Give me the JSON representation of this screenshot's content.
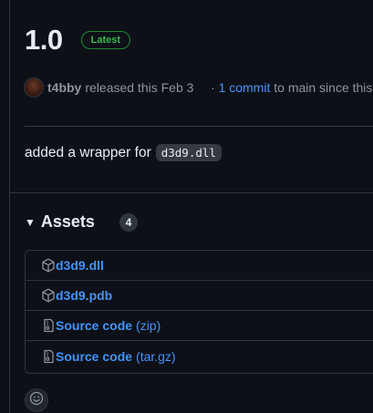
{
  "release": {
    "title": "1.0",
    "badge": "Latest",
    "author": "t4bby",
    "released_text": "released this Feb 3",
    "commits_prefix": "· ",
    "commits_link": "1 commit",
    "commits_suffix": " to main since this"
  },
  "body": {
    "text": "added a wrapper for",
    "code": "d3d9.dll"
  },
  "assets": {
    "label": "Assets",
    "count": "4",
    "items": [
      {
        "name": "d3d9.dll",
        "sub": "",
        "icon": "package-icon"
      },
      {
        "name": "d3d9.pdb",
        "sub": "",
        "icon": "package-icon"
      },
      {
        "name": "Source code",
        "sub": "(zip)",
        "icon": "file-zip-icon"
      },
      {
        "name": "Source code",
        "sub": "(tar.gz)",
        "icon": "file-zip-icon"
      }
    ]
  },
  "colors": {
    "background": "#0d1117",
    "border": "#30363d",
    "link": "#4493f8",
    "latest_green": "#3fb950",
    "muted": "#8b949e"
  }
}
